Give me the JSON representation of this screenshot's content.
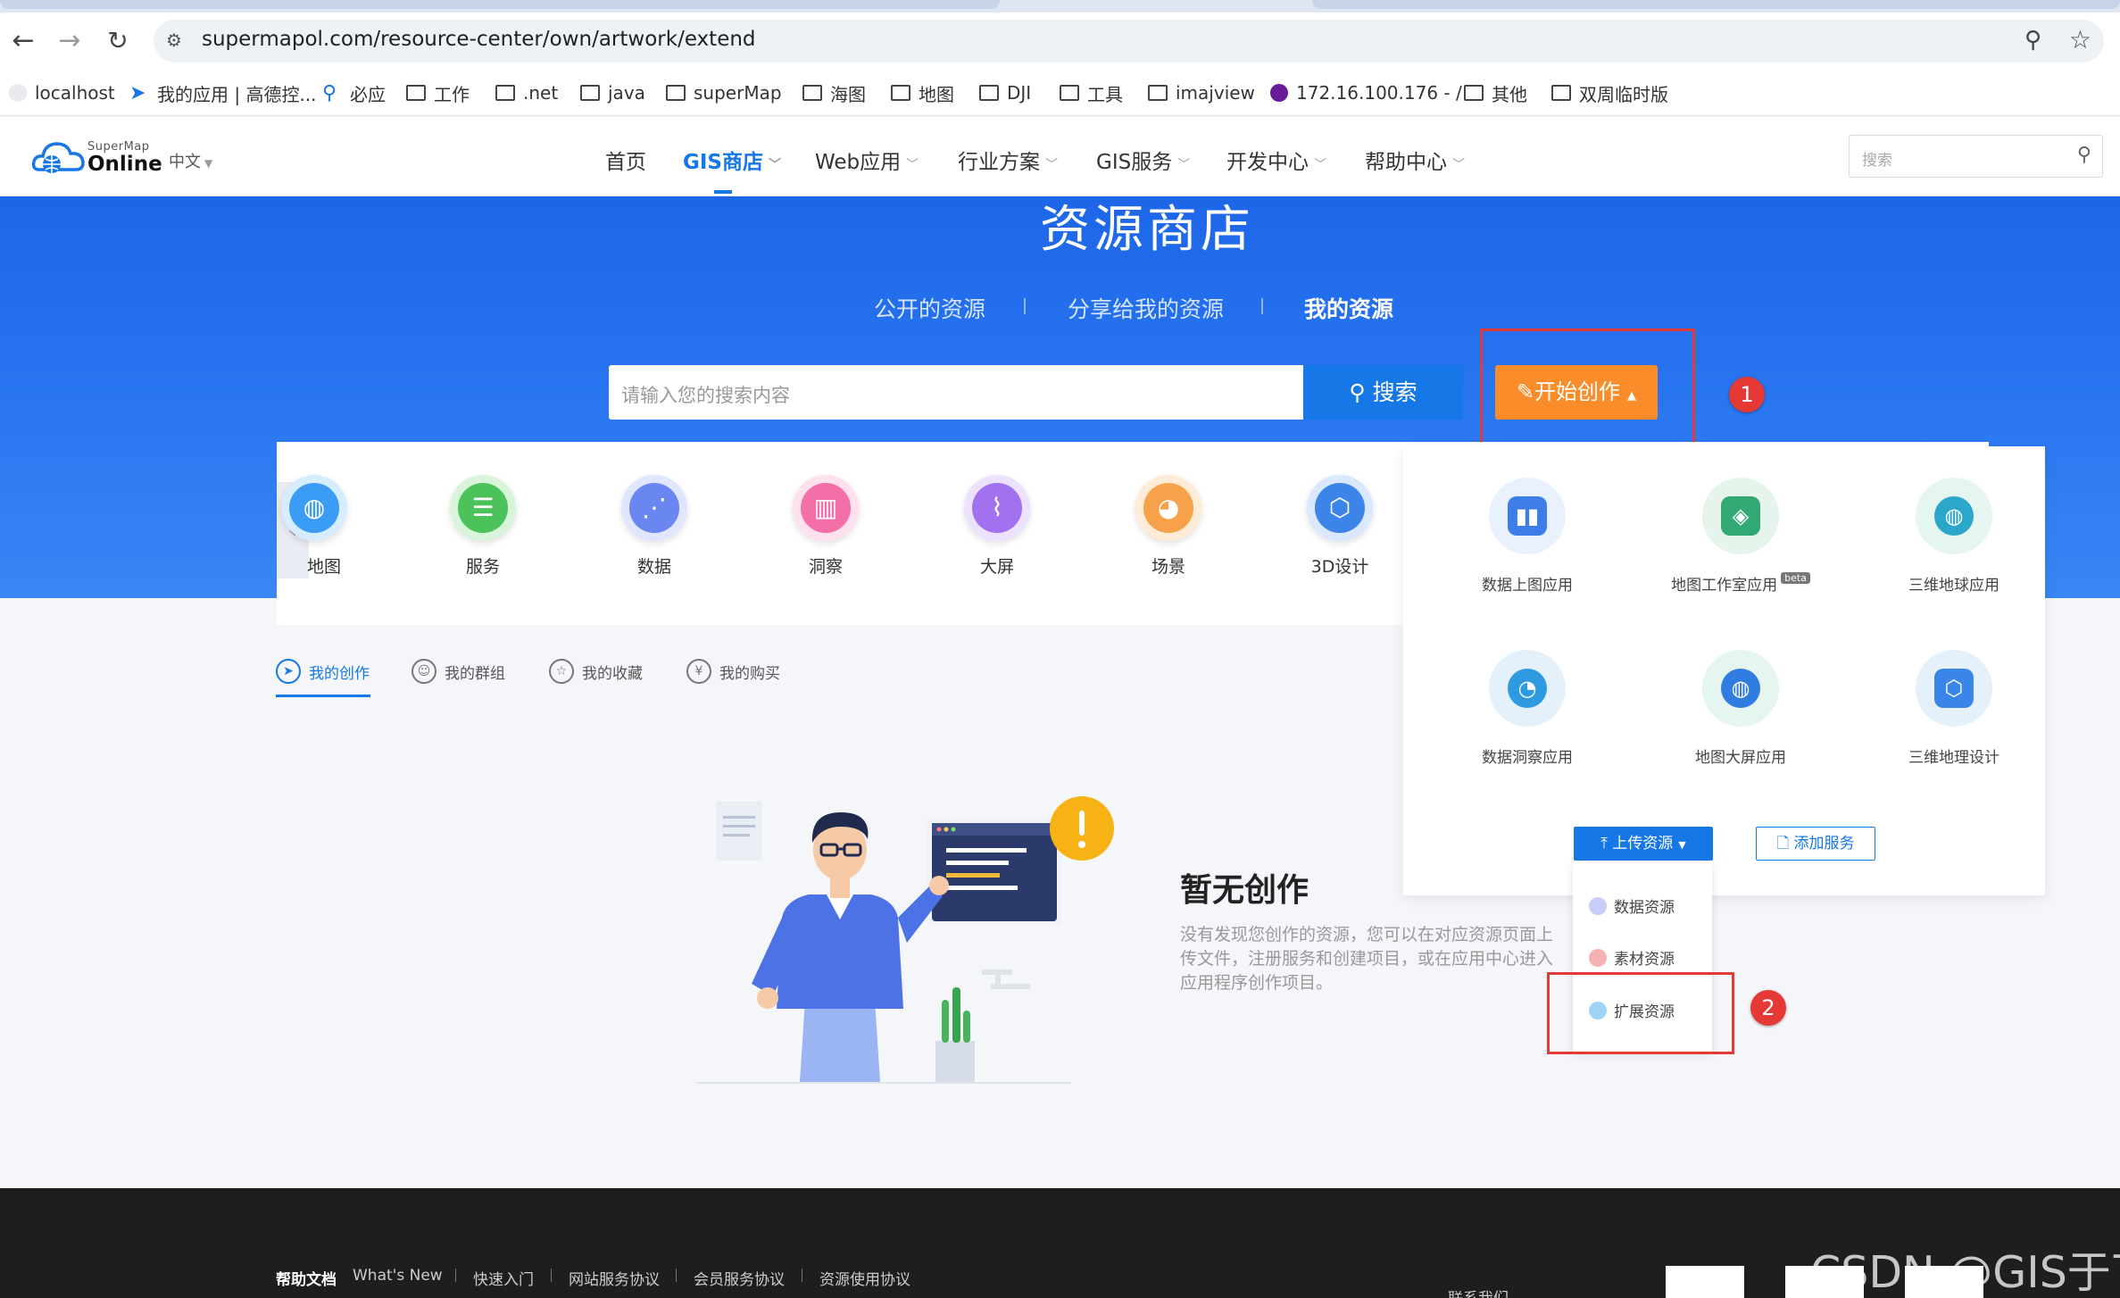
{
  "browser": {
    "url": "supermapol.com/resource-center/own/artwork/extend",
    "bookmarks": [
      "localhost",
      "我的应用 | 高德控...",
      "必应",
      "工作",
      ".net",
      "java",
      "superMap",
      "海图",
      "地图",
      "DJI",
      "工具",
      "imajview",
      "172.16.100.176 - /",
      "其他",
      "双周临时版"
    ]
  },
  "header": {
    "logo_sub": "SuperMap",
    "logo_main": "Online",
    "lang": "中文",
    "nav": [
      "首页",
      "GIS商店",
      "Web应用",
      "行业方案",
      "GIS服务",
      "开发中心",
      "帮助中心"
    ],
    "search_placeholder": "搜索"
  },
  "hero": {
    "title": "资源商店",
    "tabs": [
      "公开的资源",
      "分享给我的资源",
      "我的资源"
    ],
    "search_placeholder": "请输入您的搜索内容",
    "search_button": "搜索",
    "create_button": "开始创作",
    "annotation1": "1"
  },
  "categories": [
    "地图",
    "服务",
    "数据",
    "洞察",
    "大屏",
    "场景",
    "3D设计"
  ],
  "apps": {
    "items": [
      "数据上图应用",
      "地图工作室应用",
      "三维地球应用",
      "数据洞察应用",
      "地图大屏应用",
      "三维地理设计"
    ],
    "beta_badge": "beta",
    "upload_button": "上传资源",
    "add_service_button": "添加服务",
    "upload_menu": [
      "数据资源",
      "素材资源",
      "扩展资源"
    ],
    "annotation2": "2"
  },
  "my_tabs": [
    "我的创作",
    "我的群组",
    "我的收藏",
    "我的购买"
  ],
  "empty": {
    "title": "暂无创作",
    "description": "没有发现您创作的资源，您可以在对应资源页面上传文件，注册服务和创建项目，或在应用中心进入应用程序创作项目。"
  },
  "footer": {
    "links": [
      "帮助文档",
      "What's New",
      "快速入门",
      "网站服务协议",
      "会员服务协议",
      "资源使用协议"
    ],
    "contact": "联系我们"
  },
  "watermark": "CSDN @GIS于丁",
  "colors": {
    "accent": "#1677e6",
    "create": "#fb8c2a",
    "annotation": "#e53935",
    "hero": "#2a77f1"
  }
}
